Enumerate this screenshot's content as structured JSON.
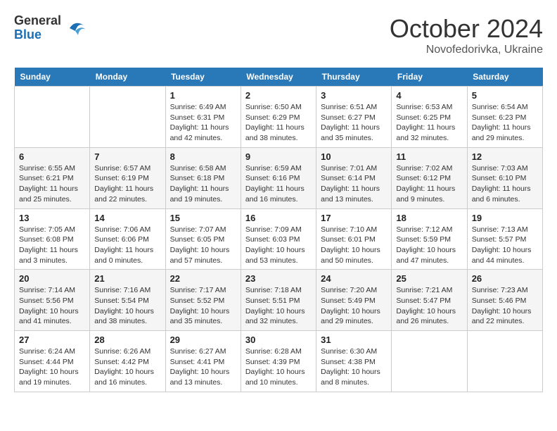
{
  "logo": {
    "general": "General",
    "blue": "Blue"
  },
  "title": {
    "month": "October 2024",
    "location": "Novofedorivka, Ukraine"
  },
  "headers": [
    "Sunday",
    "Monday",
    "Tuesday",
    "Wednesday",
    "Thursday",
    "Friday",
    "Saturday"
  ],
  "weeks": [
    [
      {
        "day": "",
        "sunrise": "",
        "sunset": "",
        "daylight": ""
      },
      {
        "day": "",
        "sunrise": "",
        "sunset": "",
        "daylight": ""
      },
      {
        "day": "1",
        "sunrise": "Sunrise: 6:49 AM",
        "sunset": "Sunset: 6:31 PM",
        "daylight": "Daylight: 11 hours and 42 minutes."
      },
      {
        "day": "2",
        "sunrise": "Sunrise: 6:50 AM",
        "sunset": "Sunset: 6:29 PM",
        "daylight": "Daylight: 11 hours and 38 minutes."
      },
      {
        "day": "3",
        "sunrise": "Sunrise: 6:51 AM",
        "sunset": "Sunset: 6:27 PM",
        "daylight": "Daylight: 11 hours and 35 minutes."
      },
      {
        "day": "4",
        "sunrise": "Sunrise: 6:53 AM",
        "sunset": "Sunset: 6:25 PM",
        "daylight": "Daylight: 11 hours and 32 minutes."
      },
      {
        "day": "5",
        "sunrise": "Sunrise: 6:54 AM",
        "sunset": "Sunset: 6:23 PM",
        "daylight": "Daylight: 11 hours and 29 minutes."
      }
    ],
    [
      {
        "day": "6",
        "sunrise": "Sunrise: 6:55 AM",
        "sunset": "Sunset: 6:21 PM",
        "daylight": "Daylight: 11 hours and 25 minutes."
      },
      {
        "day": "7",
        "sunrise": "Sunrise: 6:57 AM",
        "sunset": "Sunset: 6:19 PM",
        "daylight": "Daylight: 11 hours and 22 minutes."
      },
      {
        "day": "8",
        "sunrise": "Sunrise: 6:58 AM",
        "sunset": "Sunset: 6:18 PM",
        "daylight": "Daylight: 11 hours and 19 minutes."
      },
      {
        "day": "9",
        "sunrise": "Sunrise: 6:59 AM",
        "sunset": "Sunset: 6:16 PM",
        "daylight": "Daylight: 11 hours and 16 minutes."
      },
      {
        "day": "10",
        "sunrise": "Sunrise: 7:01 AM",
        "sunset": "Sunset: 6:14 PM",
        "daylight": "Daylight: 11 hours and 13 minutes."
      },
      {
        "day": "11",
        "sunrise": "Sunrise: 7:02 AM",
        "sunset": "Sunset: 6:12 PM",
        "daylight": "Daylight: 11 hours and 9 minutes."
      },
      {
        "day": "12",
        "sunrise": "Sunrise: 7:03 AM",
        "sunset": "Sunset: 6:10 PM",
        "daylight": "Daylight: 11 hours and 6 minutes."
      }
    ],
    [
      {
        "day": "13",
        "sunrise": "Sunrise: 7:05 AM",
        "sunset": "Sunset: 6:08 PM",
        "daylight": "Daylight: 11 hours and 3 minutes."
      },
      {
        "day": "14",
        "sunrise": "Sunrise: 7:06 AM",
        "sunset": "Sunset: 6:06 PM",
        "daylight": "Daylight: 11 hours and 0 minutes."
      },
      {
        "day": "15",
        "sunrise": "Sunrise: 7:07 AM",
        "sunset": "Sunset: 6:05 PM",
        "daylight": "Daylight: 10 hours and 57 minutes."
      },
      {
        "day": "16",
        "sunrise": "Sunrise: 7:09 AM",
        "sunset": "Sunset: 6:03 PM",
        "daylight": "Daylight: 10 hours and 53 minutes."
      },
      {
        "day": "17",
        "sunrise": "Sunrise: 7:10 AM",
        "sunset": "Sunset: 6:01 PM",
        "daylight": "Daylight: 10 hours and 50 minutes."
      },
      {
        "day": "18",
        "sunrise": "Sunrise: 7:12 AM",
        "sunset": "Sunset: 5:59 PM",
        "daylight": "Daylight: 10 hours and 47 minutes."
      },
      {
        "day": "19",
        "sunrise": "Sunrise: 7:13 AM",
        "sunset": "Sunset: 5:57 PM",
        "daylight": "Daylight: 10 hours and 44 minutes."
      }
    ],
    [
      {
        "day": "20",
        "sunrise": "Sunrise: 7:14 AM",
        "sunset": "Sunset: 5:56 PM",
        "daylight": "Daylight: 10 hours and 41 minutes."
      },
      {
        "day": "21",
        "sunrise": "Sunrise: 7:16 AM",
        "sunset": "Sunset: 5:54 PM",
        "daylight": "Daylight: 10 hours and 38 minutes."
      },
      {
        "day": "22",
        "sunrise": "Sunrise: 7:17 AM",
        "sunset": "Sunset: 5:52 PM",
        "daylight": "Daylight: 10 hours and 35 minutes."
      },
      {
        "day": "23",
        "sunrise": "Sunrise: 7:18 AM",
        "sunset": "Sunset: 5:51 PM",
        "daylight": "Daylight: 10 hours and 32 minutes."
      },
      {
        "day": "24",
        "sunrise": "Sunrise: 7:20 AM",
        "sunset": "Sunset: 5:49 PM",
        "daylight": "Daylight: 10 hours and 29 minutes."
      },
      {
        "day": "25",
        "sunrise": "Sunrise: 7:21 AM",
        "sunset": "Sunset: 5:47 PM",
        "daylight": "Daylight: 10 hours and 26 minutes."
      },
      {
        "day": "26",
        "sunrise": "Sunrise: 7:23 AM",
        "sunset": "Sunset: 5:46 PM",
        "daylight": "Daylight: 10 hours and 22 minutes."
      }
    ],
    [
      {
        "day": "27",
        "sunrise": "Sunrise: 6:24 AM",
        "sunset": "Sunset: 4:44 PM",
        "daylight": "Daylight: 10 hours and 19 minutes."
      },
      {
        "day": "28",
        "sunrise": "Sunrise: 6:26 AM",
        "sunset": "Sunset: 4:42 PM",
        "daylight": "Daylight: 10 hours and 16 minutes."
      },
      {
        "day": "29",
        "sunrise": "Sunrise: 6:27 AM",
        "sunset": "Sunset: 4:41 PM",
        "daylight": "Daylight: 10 hours and 13 minutes."
      },
      {
        "day": "30",
        "sunrise": "Sunrise: 6:28 AM",
        "sunset": "Sunset: 4:39 PM",
        "daylight": "Daylight: 10 hours and 10 minutes."
      },
      {
        "day": "31",
        "sunrise": "Sunrise: 6:30 AM",
        "sunset": "Sunset: 4:38 PM",
        "daylight": "Daylight: 10 hours and 8 minutes."
      },
      {
        "day": "",
        "sunrise": "",
        "sunset": "",
        "daylight": ""
      },
      {
        "day": "",
        "sunrise": "",
        "sunset": "",
        "daylight": ""
      }
    ]
  ]
}
